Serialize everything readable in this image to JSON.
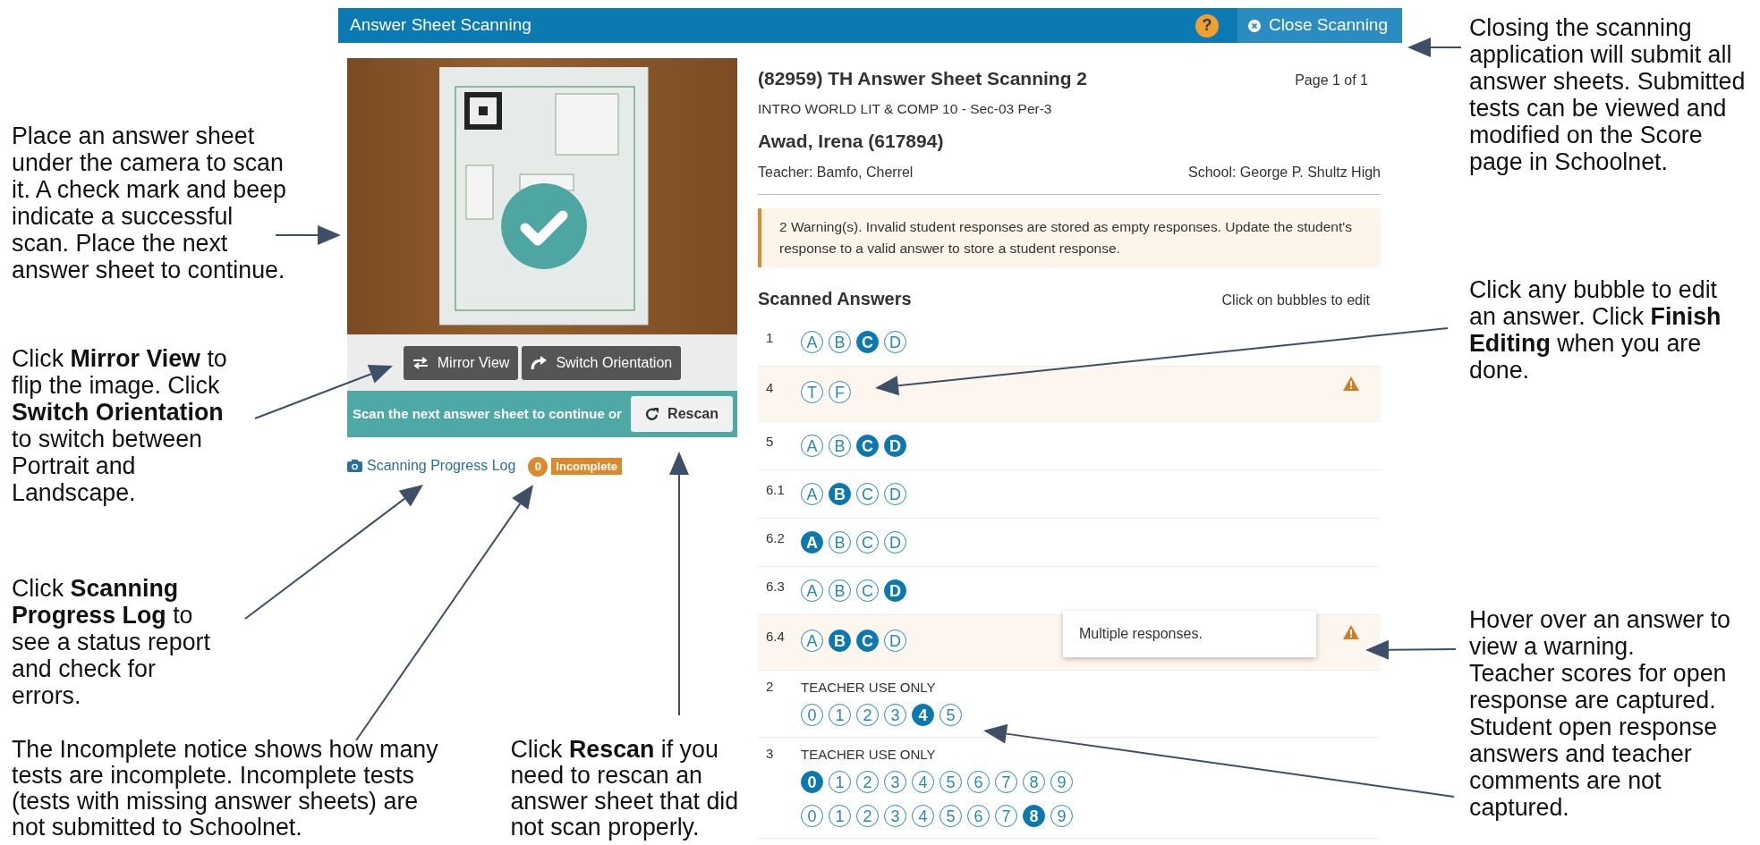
{
  "header": {
    "title": "Answer Sheet Scanning",
    "help": "?",
    "close_button": "Close Scanning"
  },
  "camera": {
    "buttons": [
      {
        "kind": "mirror",
        "label": "Mirror View"
      },
      {
        "kind": "rotate",
        "label": "Switch Orientation"
      }
    ],
    "scan_status": "Scan the next answer sheet to continue or",
    "rescan_button": "Rescan",
    "scan_success": true
  },
  "progress": {
    "log_link": "Scanning Progress Log",
    "incomplete_count": "0",
    "incomplete_label": "Incomplete"
  },
  "test": {
    "title": "(82959) TH Answer Sheet Scanning 2",
    "page": "Page 1 of 1",
    "section": "INTRO WORLD LIT & COMP 10 - Sec-03 Per-3",
    "student": "Awad, Irena (617894)",
    "teacher": "Teacher: Bamfo, Cherrel",
    "school": "School: George P. Shultz High"
  },
  "warning_message": "2 Warning(s). Invalid student responses are stored as empty responses. Update the student's response to a valid answer to store a student response.",
  "answers": {
    "heading": "Scanned Answers",
    "hint": "Click on bubbles to edit",
    "items": [
      {
        "number": "1",
        "kind": "choice",
        "warning": false,
        "rows": [
          [
            {
              "label": "A",
              "selected": false
            },
            {
              "label": "B",
              "selected": false
            },
            {
              "label": "C",
              "selected": true
            },
            {
              "label": "D",
              "selected": false
            }
          ]
        ]
      },
      {
        "number": "4",
        "kind": "choice",
        "warning": true,
        "rows": [
          [
            {
              "label": "T",
              "selected": false
            },
            {
              "label": "F",
              "selected": false
            }
          ]
        ]
      },
      {
        "number": "5",
        "kind": "choice",
        "warning": false,
        "rows": [
          [
            {
              "label": "A",
              "selected": false
            },
            {
              "label": "B",
              "selected": false
            },
            {
              "label": "C",
              "selected": true
            },
            {
              "label": "D",
              "selected": true
            }
          ]
        ]
      },
      {
        "number": "6.1",
        "kind": "choice",
        "warning": false,
        "rows": [
          [
            {
              "label": "A",
              "selected": false
            },
            {
              "label": "B",
              "selected": true
            },
            {
              "label": "C",
              "selected": false
            },
            {
              "label": "D",
              "selected": false
            }
          ]
        ]
      },
      {
        "number": "6.2",
        "kind": "choice",
        "warning": false,
        "rows": [
          [
            {
              "label": "A",
              "selected": true
            },
            {
              "label": "B",
              "selected": false
            },
            {
              "label": "C",
              "selected": false
            },
            {
              "label": "D",
              "selected": false
            }
          ]
        ]
      },
      {
        "number": "6.3",
        "kind": "choice",
        "warning": false,
        "rows": [
          [
            {
              "label": "A",
              "selected": false
            },
            {
              "label": "B",
              "selected": false
            },
            {
              "label": "C",
              "selected": false
            },
            {
              "label": "D",
              "selected": true
            }
          ]
        ]
      },
      {
        "number": "6.4",
        "kind": "choice",
        "warning": true,
        "tooltip": "Multiple responses.",
        "rows": [
          [
            {
              "label": "A",
              "selected": false
            },
            {
              "label": "B",
              "selected": true
            },
            {
              "label": "C",
              "selected": true
            },
            {
              "label": "D",
              "selected": false
            }
          ]
        ]
      },
      {
        "number": "2",
        "kind": "teacher",
        "warning": false,
        "caption": "TEACHER USE ONLY",
        "rows": [
          [
            {
              "label": "0",
              "selected": false
            },
            {
              "label": "1",
              "selected": false
            },
            {
              "label": "2",
              "selected": false
            },
            {
              "label": "3",
              "selected": false
            },
            {
              "label": "4",
              "selected": true
            },
            {
              "label": "5",
              "selected": false
            }
          ]
        ]
      },
      {
        "number": "3",
        "kind": "teacher",
        "warning": false,
        "caption": "TEACHER USE ONLY",
        "rows": [
          [
            {
              "label": "0",
              "selected": true
            },
            {
              "label": "1",
              "selected": false
            },
            {
              "label": "2",
              "selected": false
            },
            {
              "label": "3",
              "selected": false
            },
            {
              "label": "4",
              "selected": false
            },
            {
              "label": "5",
              "selected": false
            },
            {
              "label": "6",
              "selected": false
            },
            {
              "label": "7",
              "selected": false
            },
            {
              "label": "8",
              "selected": false
            },
            {
              "label": "9",
              "selected": false
            }
          ],
          [
            {
              "label": "0",
              "selected": false
            },
            {
              "label": "1",
              "selected": false
            },
            {
              "label": "2",
              "selected": false
            },
            {
              "label": "3",
              "selected": false
            },
            {
              "label": "4",
              "selected": false
            },
            {
              "label": "5",
              "selected": false
            },
            {
              "label": "6",
              "selected": false
            },
            {
              "label": "7",
              "selected": false
            },
            {
              "label": "8",
              "selected": true
            },
            {
              "label": "9",
              "selected": false
            }
          ]
        ]
      }
    ]
  },
  "notes_left": [
    "Place an answer sheet under the camera to scan it. A check mark and beep indicate a successful scan. Place the next answer sheet to continue.",
    "Click **Mirror View** to flip the image. Click **Switch Orientation** to switch between Portrait and Landscape.",
    "Click **Scanning Progress Log** to see a status report and check for errors."
  ],
  "notes_bottom": [
    "The Incomplete notice shows how many tests are incomplete. Incomplete tests (tests with missing answer sheets) are not submitted to Schoolnet.",
    "Click **Rescan** if you need to rescan an answer sheet that did not scan properly."
  ],
  "notes_right": [
    "Closing the scanning application will submit all answer sheets. Submitted tests can be viewed and modified on the Score page in Schoolnet.",
    "Click any bubble to edit an answer. Click **Finish Editing** when you are done.",
    "Hover over an answer to view a warning.",
    "Teacher scores for open response are captured. Student open response answers and teacher comments are not captured."
  ]
}
